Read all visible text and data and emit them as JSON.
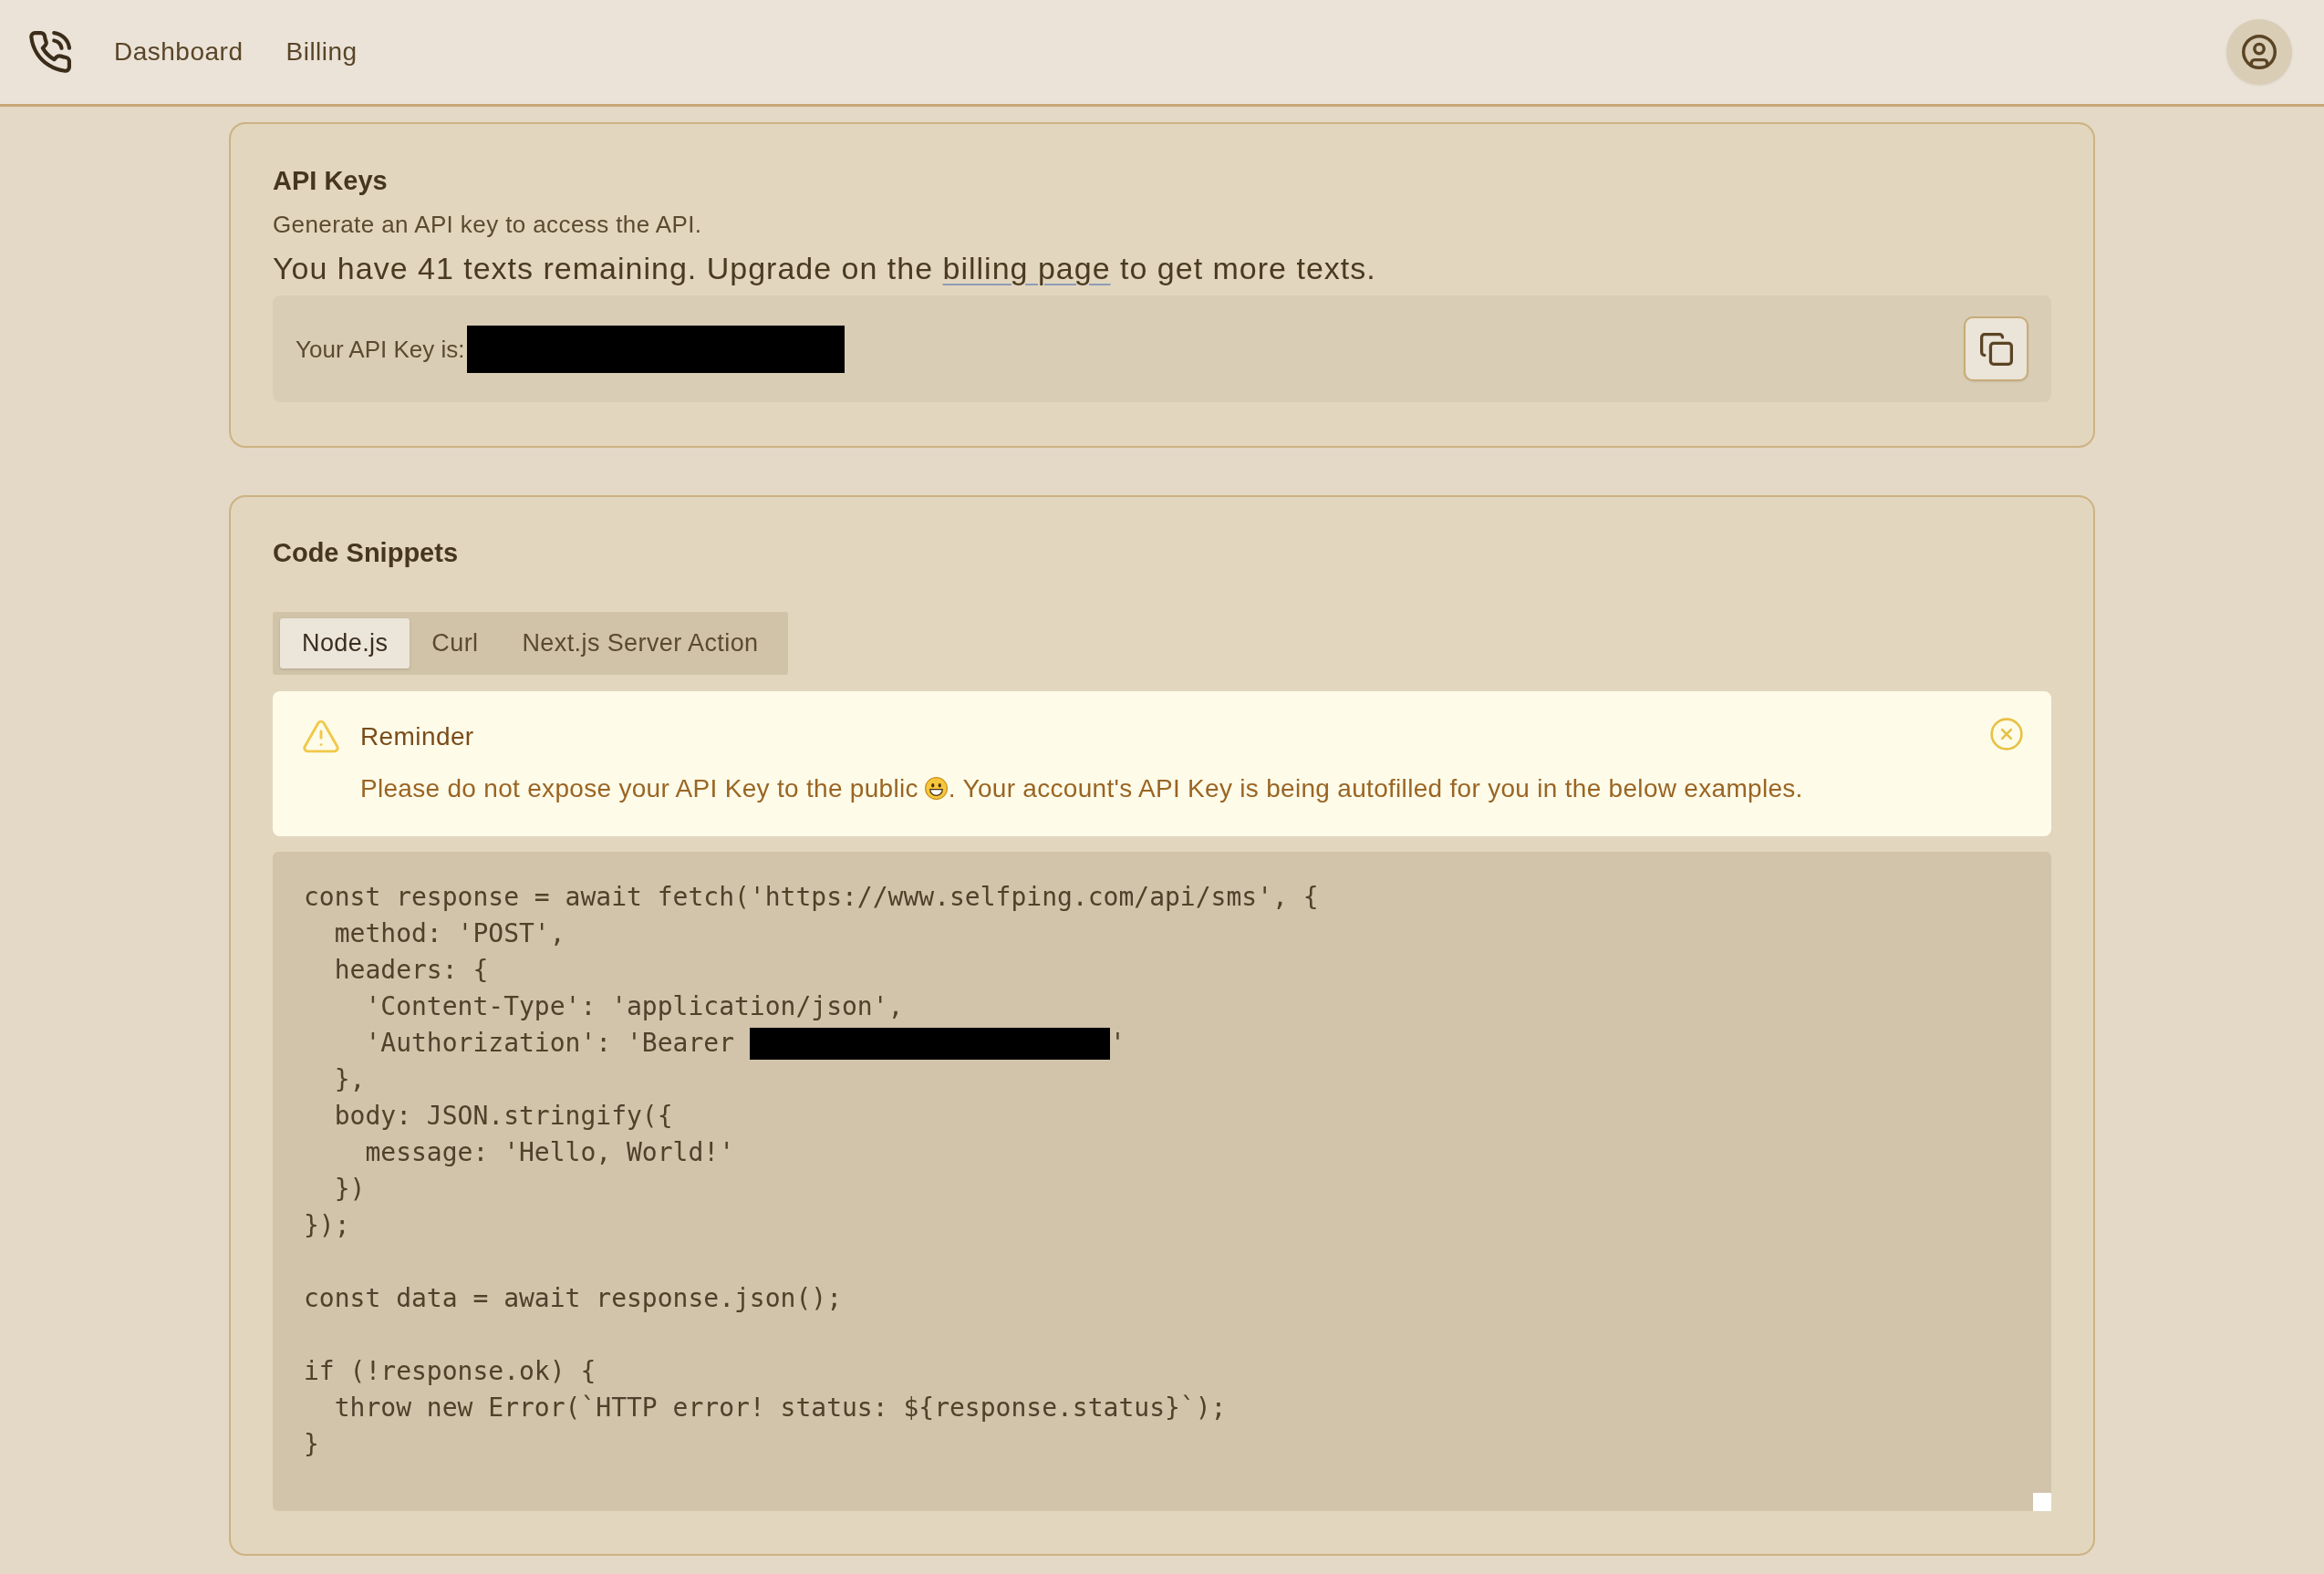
{
  "nav": {
    "links": [
      "Dashboard",
      "Billing"
    ]
  },
  "api_keys": {
    "title": "API Keys",
    "subtitle": "Generate an API key to access the API.",
    "usage": {
      "before": "You have 41 texts remaining. Upgrade on the ",
      "link": "billing page",
      "after": " to get more texts."
    },
    "key_row": {
      "label": "Your API Key is:",
      "redacted": true
    }
  },
  "code_snippets": {
    "title": "Code Snippets",
    "tabs": [
      {
        "label": "Node.js",
        "selected": true
      },
      {
        "label": "Curl",
        "selected": false
      },
      {
        "label": "Next.js Server Action",
        "selected": false
      }
    ],
    "reminder": {
      "title": "Reminder",
      "message_before_emoji": "Please do not expose your API Key to the public",
      "message_after_emoji": ". Your account's API Key is being autofilled for you in the below examples."
    },
    "code": {
      "blocks": [
        [
          {
            "text": "const response = await fetch('https://www.selfping.com/api/sms', {",
            "redacted": false
          },
          {
            "text": "  method: 'POST',",
            "redacted": false
          },
          {
            "text": "  headers: {",
            "redacted": false
          },
          {
            "text": "    'Content-Type': 'application/json',",
            "redacted": false
          },
          {
            "text": "    'Authorization': 'Bearer ",
            "redacted": true,
            "after": "'"
          },
          {
            "text": "  },",
            "redacted": false
          },
          {
            "text": "  body: JSON.stringify({",
            "redacted": false
          },
          {
            "text": "    message: 'Hello, World!'",
            "redacted": false
          },
          {
            "text": "  })",
            "redacted": false
          },
          {
            "text": "});",
            "redacted": false
          }
        ],
        [
          {
            "text": "const data = await response.json();",
            "redacted": false
          }
        ],
        [
          {
            "text": "if (!response.ok) {",
            "redacted": false
          },
          {
            "text": "  throw new Error(`HTTP error! status: ${response.status}`);",
            "redacted": false
          },
          {
            "text": "}",
            "redacted": false
          }
        ]
      ]
    }
  }
}
